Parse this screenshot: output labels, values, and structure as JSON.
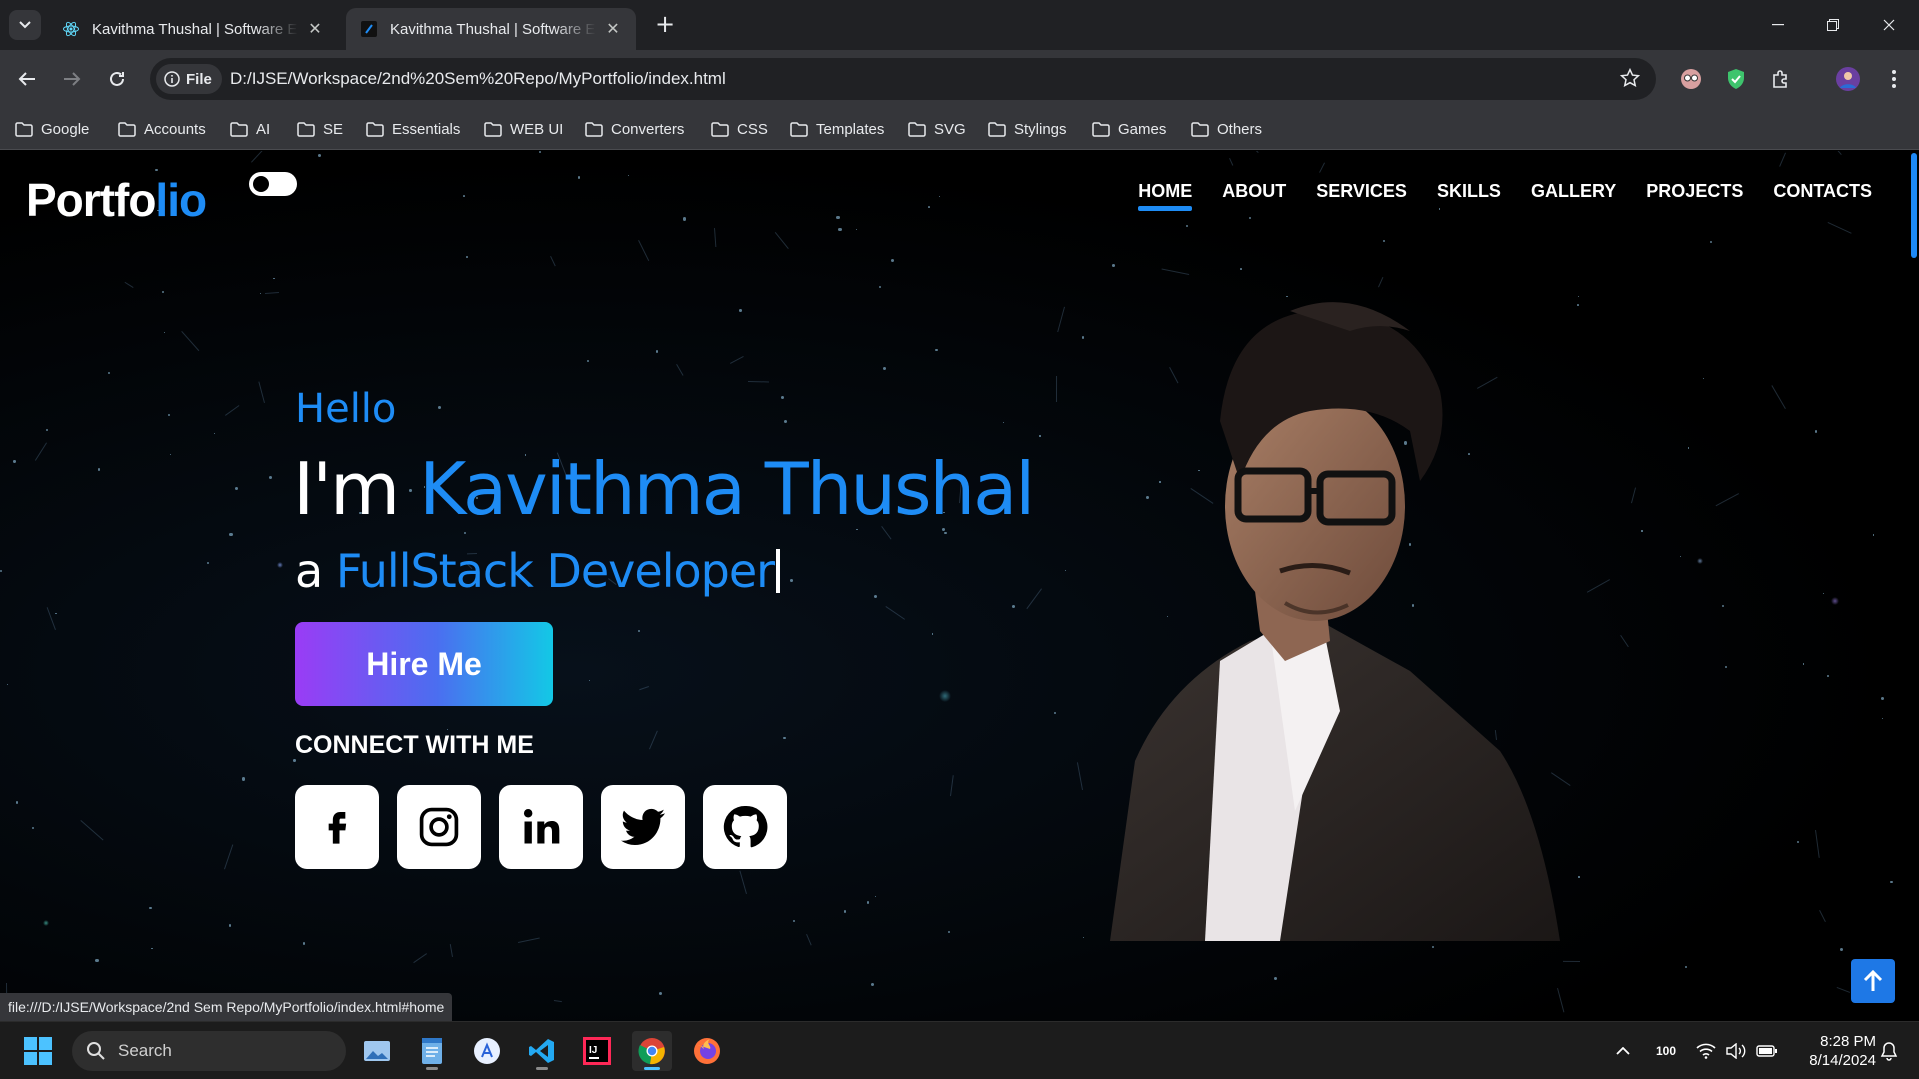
{
  "browser": {
    "tabs": [
      {
        "title": "Kavithma Thushal | Software Engineer",
        "active": false
      },
      {
        "title": "Kavithma Thushal | Software Engineer",
        "active": true
      }
    ],
    "site_chip": "File",
    "url": "D:/IJSE/Workspace/2nd%20Sem%20Repo/MyPortfolio/index.html",
    "bookmarks": [
      "Google",
      "Accounts",
      "AI",
      "SE",
      "Essentials",
      "WEB UI",
      "Converters",
      "CSS",
      "Templates",
      "SVG",
      "Stylings",
      "Games",
      "Others"
    ],
    "status_url": "file:///D:/IJSE/Workspace/2nd Sem Repo/MyPortfolio/index.html#home"
  },
  "site": {
    "logo_main": "Portfo",
    "logo_accent": "lio",
    "nav": [
      "HOME",
      "ABOUT",
      "SERVICES",
      "SKILLS",
      "GALLERY",
      "PROJECTS",
      "CONTACTS"
    ],
    "active_nav": "HOME",
    "hero": {
      "greeting": "Hello",
      "intro": "I'm",
      "name": "Kavithma Thushal",
      "role_prefix": "a",
      "role": "FullStack Developer",
      "cta": "Hire Me",
      "connect_heading": "CONNECT WITH ME",
      "socials": [
        "facebook-icon",
        "instagram-icon",
        "linkedin-icon",
        "twitter-icon",
        "github-icon"
      ]
    },
    "colors": {
      "accent": "#1e8cf5",
      "button_start": "#9a3cf5",
      "button_end": "#13c8e6"
    }
  },
  "taskbar": {
    "search_label": "Search",
    "apps": [
      "photos",
      "notepad",
      "app-store",
      "vscode",
      "intellij",
      "chrome",
      "firefox"
    ],
    "tray_badge": "100",
    "time": "8:28 PM",
    "date": "8/14/2024"
  }
}
